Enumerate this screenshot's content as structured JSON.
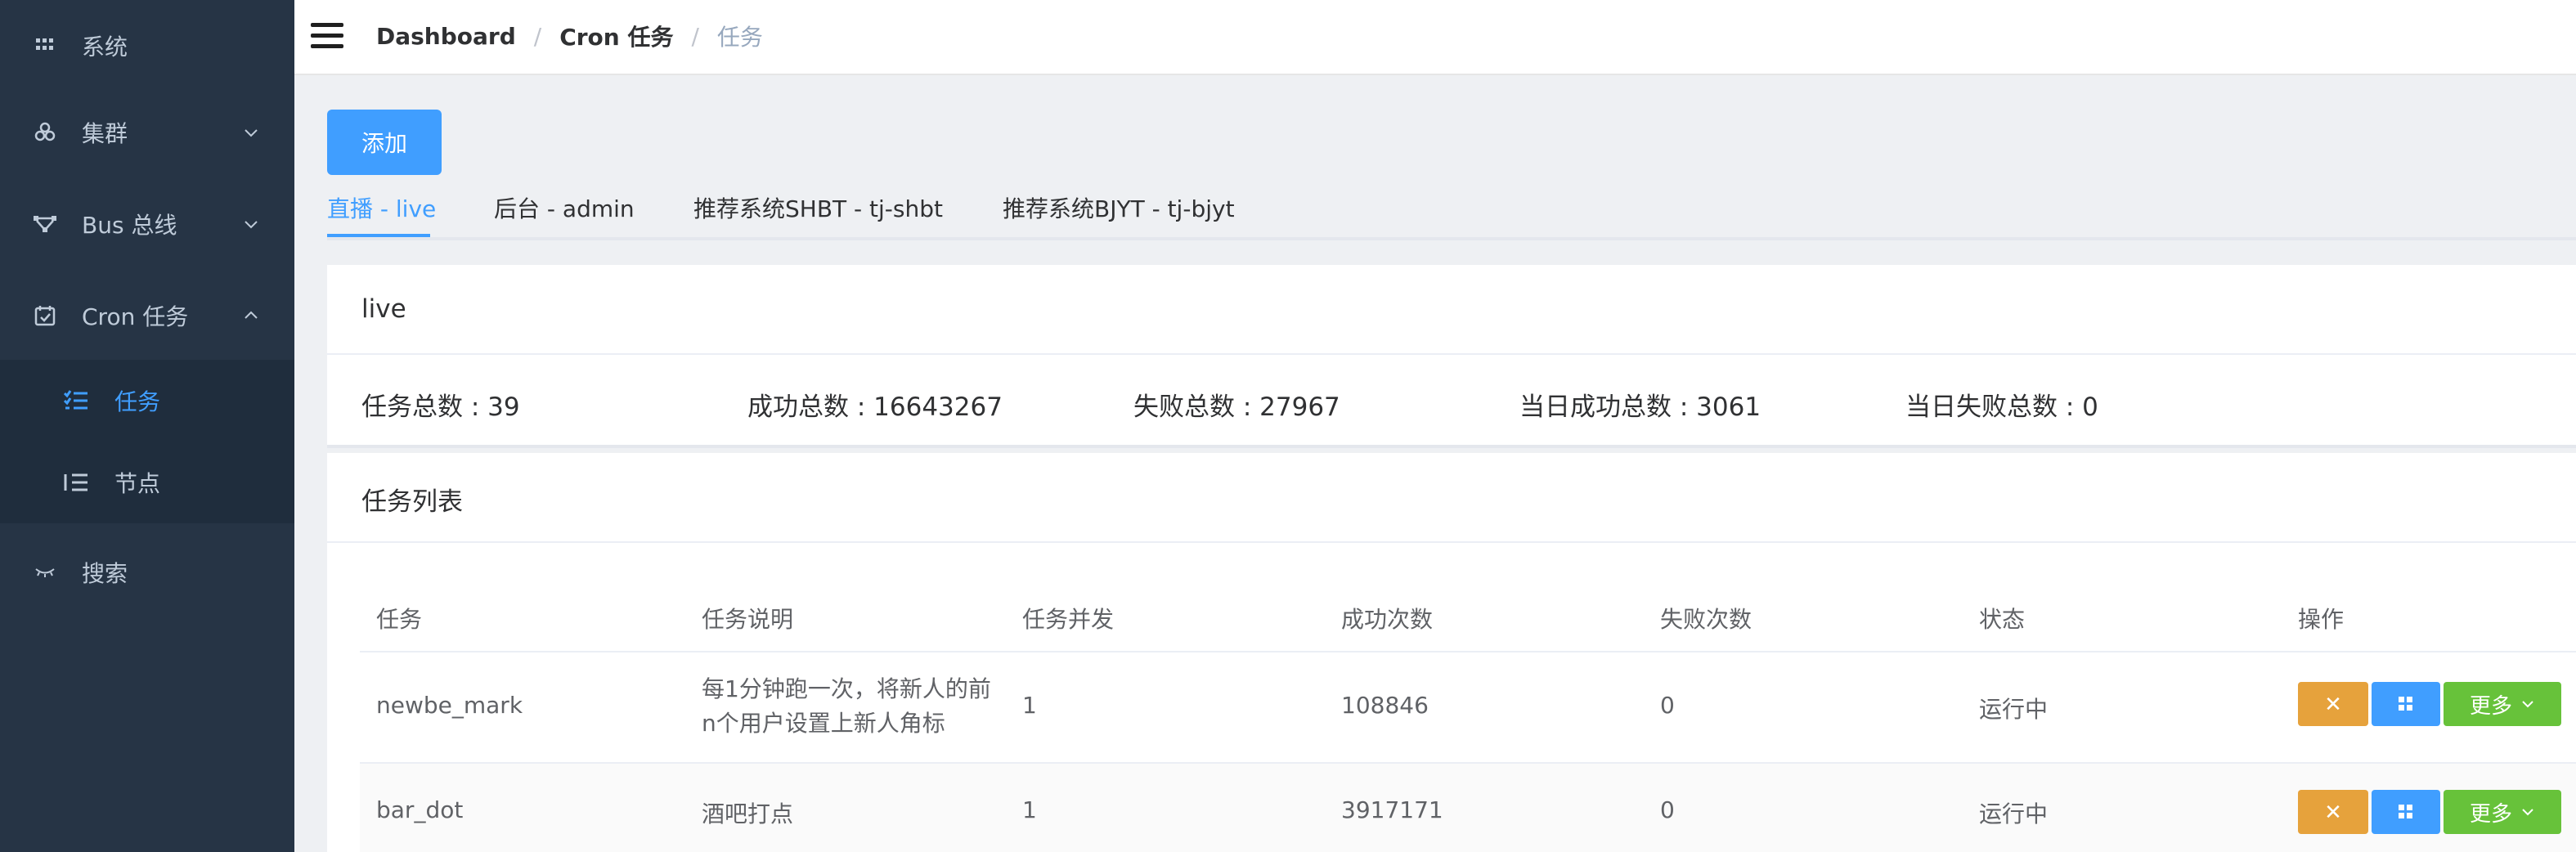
{
  "sidebar": {
    "items": [
      {
        "label": "系统",
        "icon": "grid-icon"
      },
      {
        "label": "集群",
        "icon": "cubes-icon"
      },
      {
        "label": "Bus 总线",
        "icon": "network-icon"
      },
      {
        "label": "Cron 任务",
        "icon": "calendar-check-icon"
      },
      {
        "label": "搜索",
        "icon": "eye-closed-icon"
      }
    ],
    "submenu": [
      {
        "label": "任务",
        "icon": "checklist-icon",
        "active": true
      },
      {
        "label": "节点",
        "icon": "list-icon",
        "active": false
      }
    ]
  },
  "breadcrumb": {
    "items": [
      "Dashboard",
      "Cron 任务",
      "任务"
    ],
    "separator": "/"
  },
  "toolbar": {
    "add_label": "添加"
  },
  "tabs": [
    {
      "label": "直播 - live",
      "active": true
    },
    {
      "label": "后台 - admin",
      "active": false
    },
    {
      "label": "推荐系统SHBT - tj-shbt",
      "active": false
    },
    {
      "label": "推荐系统BJYT - tj-bjyt",
      "active": false
    }
  ],
  "summary_card": {
    "title": "live"
  },
  "stats": [
    "任务总数 : 39",
    "成功总数 : 16643267",
    "失败总数 : 27967",
    "当日成功总数 : 3061",
    "当日失败总数 : 0"
  ],
  "task_list": {
    "title": "任务列表",
    "columns": [
      "任务",
      "任务说明",
      "任务并发",
      "成功次数",
      "失败次数",
      "状态",
      "操作"
    ],
    "rows": [
      {
        "name": "newbe_mark",
        "desc": "每1分钟跑一次，将新人的前n个用户设置上新人角标",
        "concurrency": "1",
        "success": "108846",
        "fail": "0",
        "status": "运行中"
      },
      {
        "name": "bar_dot",
        "desc": "酒吧打点",
        "concurrency": "1",
        "success": "3917171",
        "fail": "0",
        "status": "运行中"
      }
    ],
    "actions": {
      "delete_symbol": "✕",
      "more_label": "更多"
    }
  },
  "colors": {
    "sidebar_bg": "#263445",
    "submenu_bg": "#1f2d3d",
    "primary": "#409eff",
    "warning": "#e6a23c",
    "success": "#67c23a"
  }
}
